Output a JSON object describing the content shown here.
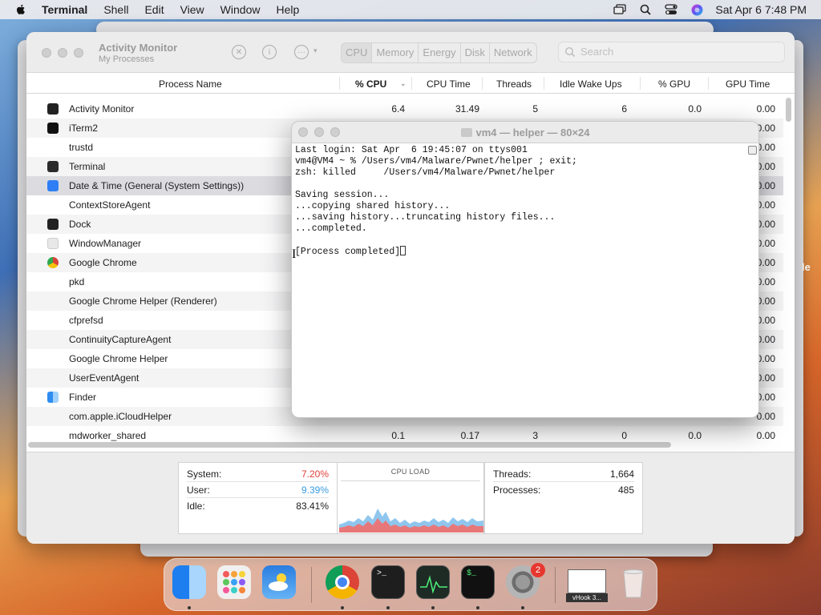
{
  "menubar": {
    "items": [
      "Terminal",
      "Shell",
      "Edit",
      "View",
      "Window",
      "Help"
    ],
    "clock": "Sat Apr 6  7:48 PM"
  },
  "activity_monitor": {
    "title": "Activity Monitor",
    "subtitle": "My Processes",
    "tabs": [
      "CPU",
      "Memory",
      "Energy",
      "Disk",
      "Network"
    ],
    "search_placeholder": "Search",
    "columns": {
      "name": "Process Name",
      "cpu": "% CPU",
      "cpu_time": "CPU Time",
      "threads": "Threads",
      "idle": "Idle Wake Ups",
      "gpu": "% GPU",
      "gpu_time": "GPU Time"
    },
    "rows": [
      {
        "name": "Activity Monitor",
        "cpu": "6.4",
        "cpu_time": "31.49",
        "threads": "5",
        "idle": "6",
        "gpu": "0.0",
        "gpu_time": "0.00",
        "icon": "activity-monitor-icon",
        "color": "#222222"
      },
      {
        "name": "iTerm2",
        "gpu_time": "0.00",
        "icon": "iterm2-icon",
        "color": "#111111"
      },
      {
        "name": "trustd",
        "gpu_time": "0.00"
      },
      {
        "name": "Terminal",
        "gpu_time": "0.00",
        "icon": "terminal-icon",
        "color": "#2b2b2b"
      },
      {
        "name": "Date & Time (General (System Settings))",
        "gpu_time": "0.00",
        "icon": "date-time-icon",
        "color": "#2f7ef5"
      },
      {
        "name": "ContextStoreAgent",
        "gpu_time": "0.00"
      },
      {
        "name": "Dock",
        "gpu_time": "0.00",
        "icon": "dock-icon",
        "color": "#222222"
      },
      {
        "name": "WindowManager",
        "gpu_time": "0.00",
        "icon": "window-manager-icon",
        "color": "#e8e8e8"
      },
      {
        "name": "Google Chrome",
        "gpu_time": "0.00",
        "icon": "chrome-icon",
        "color": "#d9443a"
      },
      {
        "name": "pkd",
        "gpu_time": "0.00"
      },
      {
        "name": "Google Chrome Helper (Renderer)",
        "gpu_time": "0.00"
      },
      {
        "name": "cfprefsd",
        "gpu_time": "0.00"
      },
      {
        "name": "ContinuityCaptureAgent",
        "gpu_time": "0.00"
      },
      {
        "name": "Google Chrome Helper",
        "gpu_time": "0.00"
      },
      {
        "name": "UserEventAgent",
        "gpu_time": "0.00"
      },
      {
        "name": "Finder",
        "gpu_time": "0.00",
        "icon": "finder-icon",
        "color": "#2f8cf0"
      },
      {
        "name": "com.apple.iCloudHelper",
        "gpu_time": "0.00"
      },
      {
        "name": "mdworker_shared",
        "cpu": "0.1",
        "cpu_time": "0.17",
        "threads": "3",
        "idle": "0",
        "gpu": "0.0",
        "gpu_time": "0.00"
      }
    ],
    "stats": {
      "system_label": "System:",
      "system_value": "7.20%",
      "user_label": "User:",
      "user_value": "9.39%",
      "idle_label": "Idle:",
      "idle_value": "83.41%",
      "cpu_load_label": "CPU LOAD",
      "threads_label": "Threads:",
      "threads_value": "1,664",
      "processes_label": "Processes:",
      "processes_value": "485"
    },
    "colors": {
      "system": "#e0403a",
      "user": "#3a9be0"
    }
  },
  "terminal": {
    "title": "vm4 — helper — 80×24",
    "lines": [
      "Last login: Sat Apr  6 19:45:07 on ttys001",
      "vm4@VM4 ~ % /Users/vm4/Malware/Pwnet/helper ; exit;",
      "zsh: killed     /Users/vm4/Malware/Pwnet/helper",
      "",
      "Saving session...",
      "...copying shared history...",
      "...saving history...truncating history files...",
      "...completed.",
      "",
      "[Process completed]"
    ]
  },
  "dock": {
    "apps": [
      "finder-icon",
      "launchpad-icon",
      "weather-icon",
      "chrome-icon",
      "terminal-icon",
      "activity-monitor-icon",
      "iterm2-icon",
      "system-settings-icon",
      "trash-icon"
    ],
    "settings_badge": "2",
    "thumbnail_label": "vHook 3..."
  },
  "desktop": {
    "edge_letter": "le"
  }
}
